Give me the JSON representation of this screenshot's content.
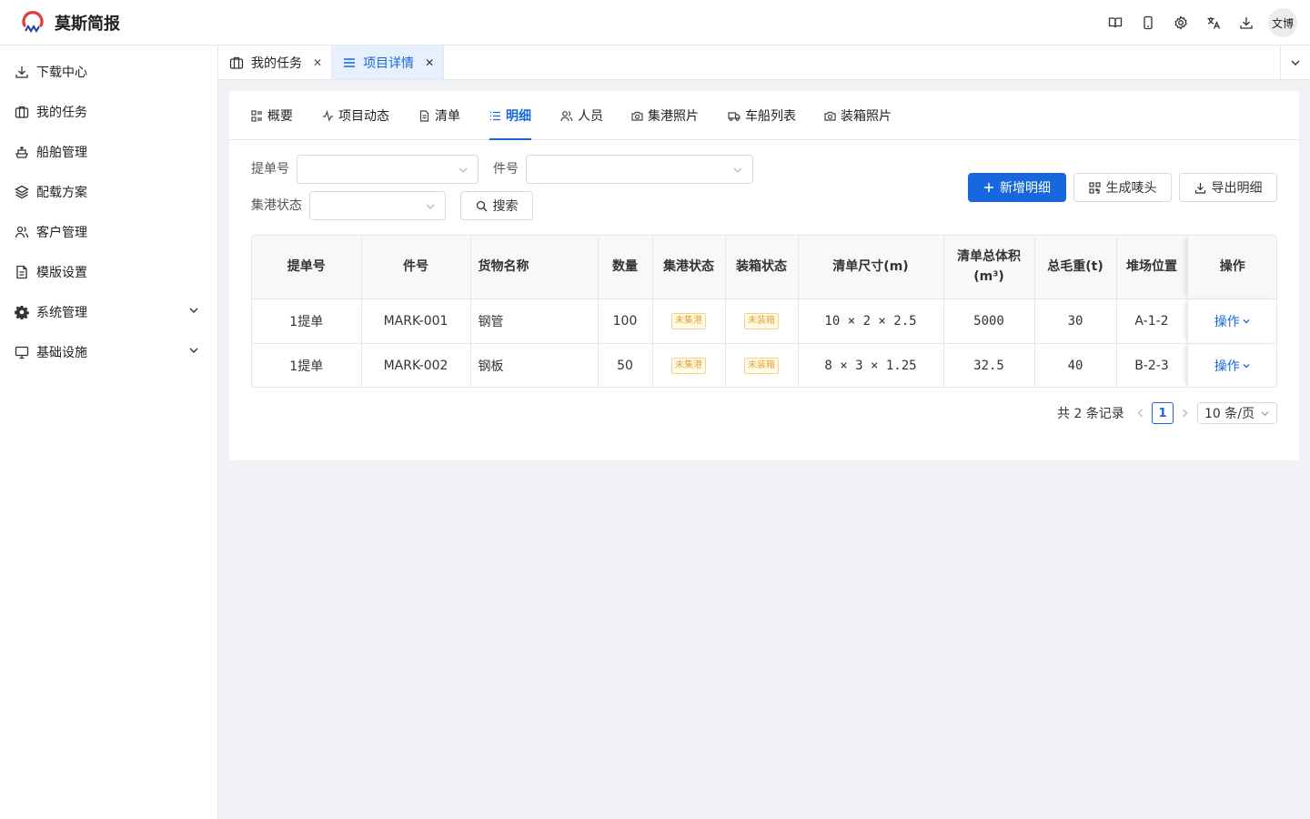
{
  "app": {
    "name": "莫斯简报",
    "user": "文博"
  },
  "topbar": {
    "icons": [
      "book-icon",
      "mobile-icon",
      "settings-icon",
      "translate-icon",
      "download-icon"
    ]
  },
  "sidebar": {
    "items": [
      {
        "label": "下载中心",
        "icon": "download-icon"
      },
      {
        "label": "我的任务",
        "icon": "briefcase-icon"
      },
      {
        "label": "船舶管理",
        "icon": "ship-icon"
      },
      {
        "label": "配载方案",
        "icon": "layers-icon"
      },
      {
        "label": "客户管理",
        "icon": "users-icon"
      },
      {
        "label": "模版设置",
        "icon": "document-icon"
      },
      {
        "label": "系统管理",
        "icon": "gear-icon",
        "expandable": true
      },
      {
        "label": "基础设施",
        "icon": "monitor-icon",
        "expandable": true
      }
    ]
  },
  "page_tabs": [
    {
      "label": "我的任务",
      "active": false
    },
    {
      "label": "项目详情",
      "active": true
    }
  ],
  "sub_tabs": [
    {
      "label": "概要"
    },
    {
      "label": "项目动态"
    },
    {
      "label": "清单"
    },
    {
      "label": "明细",
      "active": true
    },
    {
      "label": "人员"
    },
    {
      "label": "集港照片"
    },
    {
      "label": "车船列表"
    },
    {
      "label": "装箱照片"
    }
  ],
  "filters": {
    "bill_label": "提单号",
    "bill_value": "",
    "piece_label": "件号",
    "piece_value": "",
    "port_status_label": "集港状态",
    "port_status_value": "",
    "search_button": "搜索"
  },
  "actions": {
    "add": "新增明细",
    "mark": "生成唛头",
    "export": "导出明细"
  },
  "table": {
    "headers": {
      "bill": "提单号",
      "piece": "件号",
      "goods": "货物名称",
      "qty": "数量",
      "port_status": "集港状态",
      "pack_status": "装箱状态",
      "size_line1": "清单尺寸(m)",
      "vol_line1": "清单总体积",
      "vol_line2": "(m³)",
      "weight": "总毛重(t)",
      "yard": "堆场位置",
      "op": "操作"
    },
    "rows": [
      {
        "bill": "1提单",
        "piece": "MARK-001",
        "goods": "钢管",
        "qty": "100",
        "port_status": "未集港",
        "pack_status": "未装箱",
        "size": "10 × 2 × 2.5",
        "volume": "5000",
        "weight": "30",
        "yard": "A-1-2",
        "op": "操作"
      },
      {
        "bill": "1提单",
        "piece": "MARK-002",
        "goods": "钢板",
        "qty": "50",
        "port_status": "未集港",
        "pack_status": "未装箱",
        "size": "8 × 3 × 1.25",
        "volume": "32.5",
        "weight": "40",
        "yard": "B-2-3",
        "op": "操作"
      }
    ]
  },
  "pagination": {
    "total": "共 2 条记录",
    "current": "1",
    "page_size": "10 条/页"
  },
  "colors": {
    "primary": "#1668dc",
    "warning_text": "#e6a23c",
    "warning_bg": "#fffbe6"
  }
}
